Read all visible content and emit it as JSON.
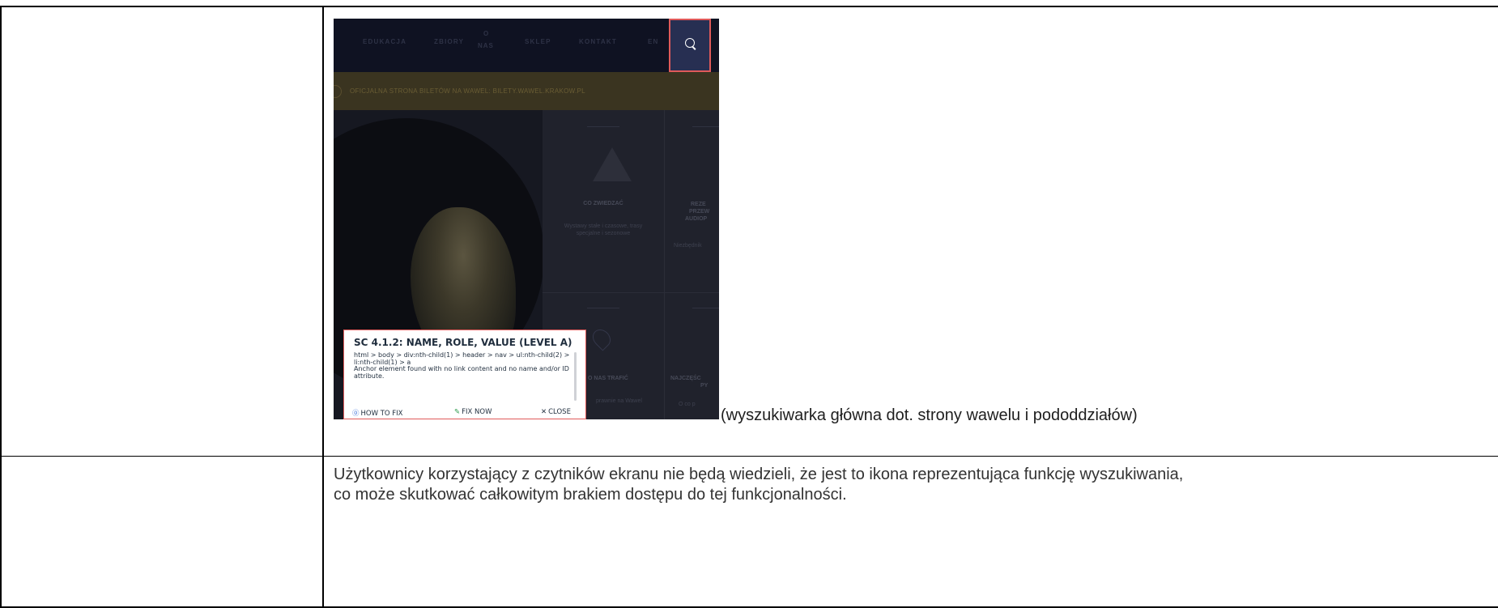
{
  "screenshot": {
    "nav": {
      "items": [
        "EDUKACJA",
        "ZBIORY",
        "SKLEP",
        "KONTAKT",
        "EN"
      ],
      "o_nas_top": "O",
      "o_nas_bottom": "NAS"
    },
    "banner_text": "OFICJALNA STRONA BILETÓW NA WAWEL: BILETY.WAWEL.KRAKOW.PL",
    "cards": {
      "card1_title": "CO ZWIEDZAĆ",
      "card1_desc_1": "Wystawy stałe i czasowe, trasy",
      "card1_desc_2": "specjalne i sezonowe",
      "card2_title_1": "REZE",
      "card2_title_2": "PRZEW",
      "card2_title_3": "AUDIOP",
      "card2_desc": "Niezbędnik",
      "card3_title": "O NAS TRAFIĆ",
      "card3_desc": "prawnie na Wawel",
      "card4_title_1": "NAJCZĘŚC",
      "card4_title_2": "PY",
      "card4_desc": "O co p"
    },
    "popup": {
      "title": "SC 4.1.2: NAME, ROLE, VALUE (LEVEL A)",
      "selector": "html > body > div:nth-child(1) > header > nav > ul:nth-child(2) > li:nth-child(1) > a",
      "message": "Anchor element found with no link content and no name and/or ID attribute.",
      "how_to_fix": "HOW TO FIX",
      "fix_now": "FIX NOW",
      "close": "CLOSE"
    }
  },
  "caption": "(wyszukiwarka główna dot. strony wawelu i pododdziałów)",
  "description_line1": "Użytkownicy korzystający z czytników ekranu nie będą wiedzieli, że jest to ikona reprezentująca funkcję wyszukiwania,",
  "description_line2": "co może skutkować całkowitym brakiem dostępu do tej funkcjonalności.",
  "colors": {
    "highlight_border": "#e05a5a",
    "nav_background": "#0f1222",
    "search_button": "#272f52"
  },
  "icons": {
    "search": "search-icon",
    "help": "help-circle-icon",
    "fix": "wrench-icon",
    "close": "close-icon"
  }
}
